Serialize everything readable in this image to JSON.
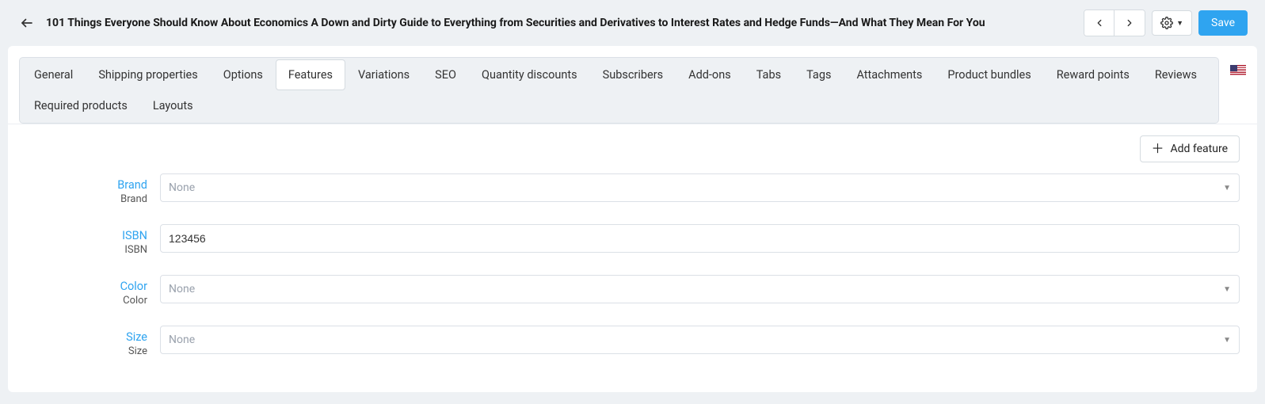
{
  "header": {
    "title": "101 Things Everyone Should Know About Economics A Down and Dirty Guide to Everything from Securities and Derivatives to Interest Rates and Hedge Funds—And What They Mean For You",
    "save_label": "Save"
  },
  "tabs": {
    "items": [
      "General",
      "Shipping properties",
      "Options",
      "Features",
      "Variations",
      "SEO",
      "Quantity discounts",
      "Subscribers",
      "Add-ons",
      "Tabs",
      "Tags",
      "Attachments",
      "Product bundles",
      "Reward points",
      "Reviews",
      "Required products",
      "Layouts"
    ],
    "active_index": 3
  },
  "actions": {
    "add_feature_label": "Add feature"
  },
  "features": [
    {
      "label_link": "Brand",
      "label_sub": "Brand",
      "type": "select",
      "value": "None"
    },
    {
      "label_link": "ISBN",
      "label_sub": "ISBN",
      "type": "text",
      "value": "123456"
    },
    {
      "label_link": "Color",
      "label_sub": "Color",
      "type": "select",
      "value": "None"
    },
    {
      "label_link": "Size",
      "label_sub": "Size",
      "type": "select",
      "value": "None"
    }
  ]
}
